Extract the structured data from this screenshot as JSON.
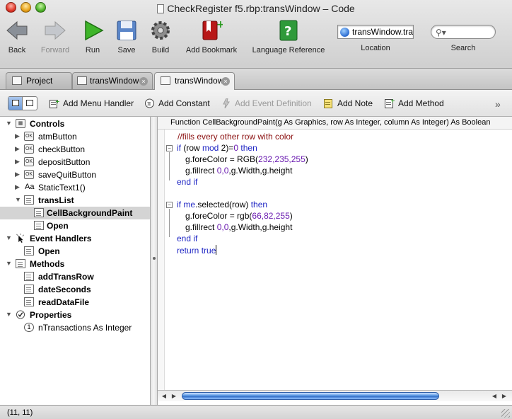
{
  "window": {
    "title": "CheckRegister f5.rbp:transWindow – Code"
  },
  "toolbar": {
    "back": "Back",
    "forward": "Forward",
    "run": "Run",
    "save": "Save",
    "build": "Build",
    "add_bookmark": "Add Bookmark",
    "language_reference": "Language Reference",
    "location_value": "transWindow.tra",
    "location_label": "Location",
    "search_placeholder": "",
    "search_label": "Search"
  },
  "tabs": [
    {
      "label": "Project"
    },
    {
      "label": "transWindow"
    },
    {
      "label": "transWindow"
    }
  ],
  "editor_toolbar": {
    "add_menu_handler": "Add Menu Handler",
    "add_constant": "Add Constant",
    "add_event_definition": "Add Event Definition",
    "add_note": "Add Note",
    "add_method": "Add Method",
    "more": "»"
  },
  "tree": {
    "controls": "Controls",
    "atmButton": "atmButton",
    "checkButton": "checkButton",
    "depositButton": "depositButton",
    "saveQuitButton": "saveQuitButton",
    "staticText1": "StaticText1()",
    "transList": "transList",
    "cellBackgroundPaint": "CellBackgroundPaint",
    "open1": "Open",
    "eventHandlers": "Event Handlers",
    "open2": "Open",
    "methods": "Methods",
    "addTransRow": "addTransRow",
    "dateSeconds": "dateSeconds",
    "readDataFile": "readDataFile",
    "properties": "Properties",
    "nTransactions": "nTransactions As Integer",
    "ok_badge": "OK",
    "aa_badge": "Aa",
    "prop_badge": "1"
  },
  "code": {
    "signature": "Function CellBackgroundPaint(g As Graphics, row As Integer, column As Integer) As Boolean",
    "l1": "//fills every other row with color",
    "l2_kw": "if",
    "l2_a": " (row ",
    "l2_mod": "mod",
    "l2_b": " 2)=",
    "l2_n": "0",
    "l2_then": " then",
    "l3_a": "g.foreColor = RGB(",
    "l3_n": "232,235,255",
    "l3_b": ")",
    "l4_a": "g.fillrect ",
    "l4_n": "0,0",
    "l4_b": ",g.Width,g.height",
    "l5": "end if",
    "l6_kw": "if",
    "l6_me": " me",
    "l6_a": ".selected(row) ",
    "l6_then": "then",
    "l7_a": "g.foreColor = rgb(",
    "l7_n": "66,82,255",
    "l7_b": ")",
    "l8_a": "g.fillrect ",
    "l8_n": "0,0",
    "l8_b": ",g.Width,g.height",
    "l9": "end if",
    "l10_kw": "return",
    "l10_true": " true"
  },
  "status": {
    "position": "(11, 11)"
  }
}
